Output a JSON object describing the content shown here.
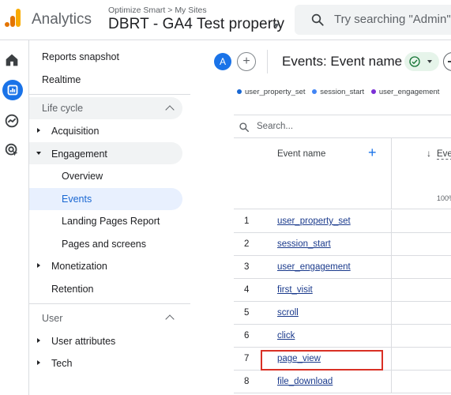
{
  "header": {
    "app_name": "Analytics",
    "breadcrumb": "Optimize Smart > My Sites",
    "property_name": "DBRT - GA4 Test property",
    "search_placeholder": "Try searching \"Admin\""
  },
  "rail": {
    "icons": [
      "home-icon",
      "reports-icon",
      "explore-icon",
      "advertising-icon"
    ],
    "active": "reports-icon",
    "accent": "#1a73e8"
  },
  "nav": {
    "reports_snapshot": "Reports snapshot",
    "realtime": "Realtime",
    "lifecycle": {
      "title": "Life cycle",
      "acquisition": "Acquisition",
      "engagement": "Engagement",
      "engagement_children": {
        "overview": "Overview",
        "events": "Events",
        "landing_pages": "Landing Pages Report",
        "pages_screens": "Pages and screens"
      },
      "monetization": "Monetization",
      "retention": "Retention"
    },
    "user": {
      "title": "User",
      "user_attributes": "User attributes",
      "tech": "Tech"
    }
  },
  "main": {
    "avatar_letter": "A",
    "add_comparison": "+",
    "report_title": "Events: Event name",
    "legend": [
      {
        "label": "user_property_set",
        "color": "#1967d2"
      },
      {
        "label": "session_start",
        "color": "#4285f4"
      },
      {
        "label": "user_engagement",
        "color": "#7b2fd6"
      }
    ],
    "table": {
      "search_placeholder": "Search...",
      "col_event_name": "Event name",
      "col_add": "+",
      "col_metric_partial": "Eve",
      "metric_sort_arrow": "↓",
      "metric_pct_partial": "100%",
      "rows": [
        {
          "num": "1",
          "name": "user_property_set"
        },
        {
          "num": "2",
          "name": "session_start"
        },
        {
          "num": "3",
          "name": "user_engagement"
        },
        {
          "num": "4",
          "name": "first_visit"
        },
        {
          "num": "5",
          "name": "scroll"
        },
        {
          "num": "6",
          "name": "click"
        },
        {
          "num": "7",
          "name": "page_view"
        },
        {
          "num": "8",
          "name": "file_download"
        }
      ],
      "highlighted_row": "7",
      "highlight_color": "#d93025"
    }
  }
}
